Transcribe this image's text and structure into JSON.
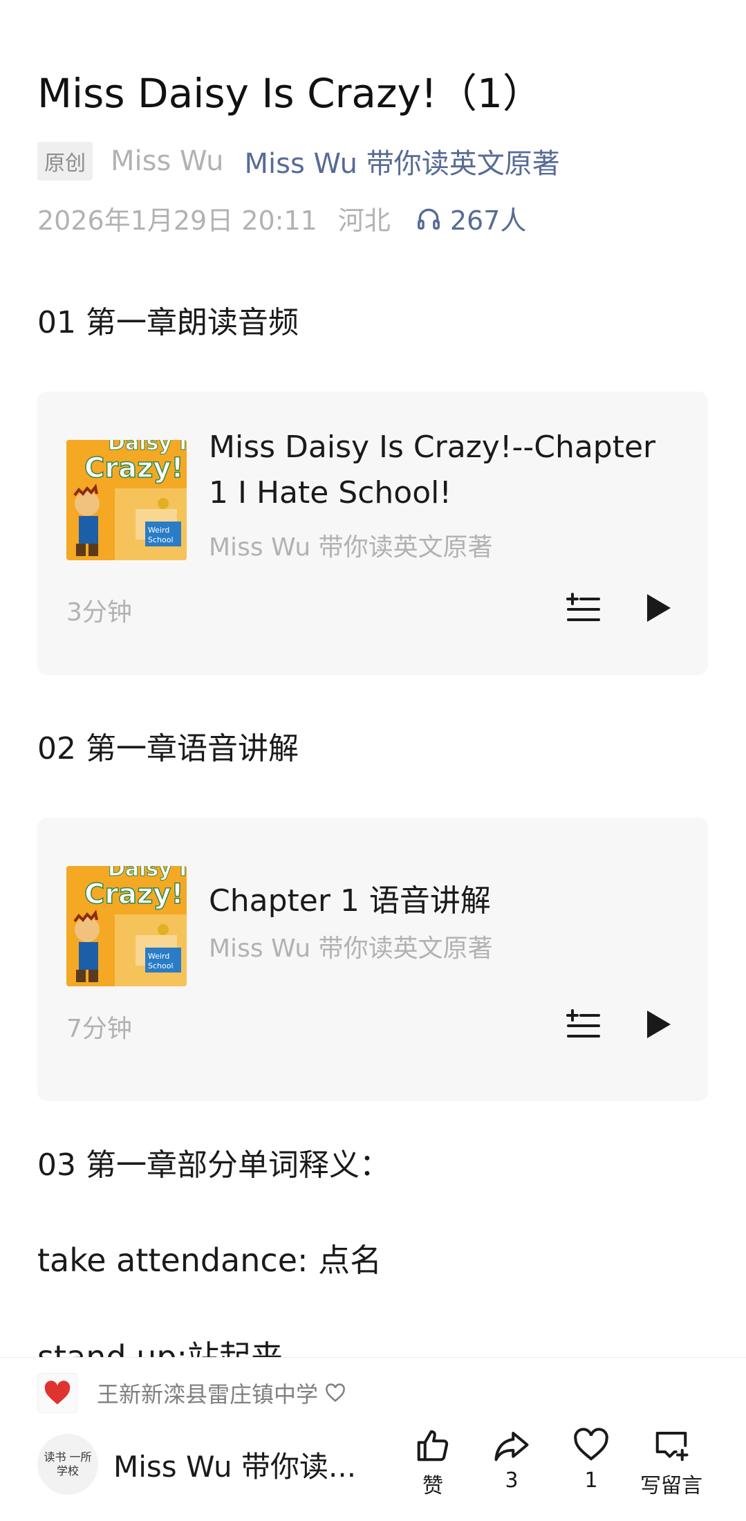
{
  "article": {
    "title": "Miss Daisy Is Crazy!（1）",
    "badge": "原创",
    "author": "Miss Wu",
    "account": "Miss Wu 带你读英文原著",
    "date": "2026年1月29日 20:11",
    "location": "河北",
    "listeners": "267人"
  },
  "sections": [
    {
      "heading": "01 第一章朗读音频"
    },
    {
      "heading": "02 第一章语音讲解"
    },
    {
      "heading": "03 第一章部分单词释义："
    }
  ],
  "audio_cards": [
    {
      "title_line1": "Miss Daisy Is Crazy!--Chapter",
      "title_line2": "1 I Hate School!",
      "subtitle": "Miss Wu 带你读英文原著",
      "duration": "3分钟",
      "cover_icon": "book-cover-icon"
    },
    {
      "title_line1": "Chapter 1 语音讲解",
      "subtitle": "Miss Wu 带你读英文原著",
      "duration": "7分钟",
      "cover_icon": "book-cover-icon"
    }
  ],
  "body": {
    "line1": "take attendance: 点名",
    "line2": "stand up:站起来"
  },
  "bottom": {
    "liker": "王新新滦县雷庄镇中学",
    "account_name": "Miss Wu 带你读...",
    "avatar_text": "读书 一所学校",
    "actions": [
      {
        "icon": "thumbs-up-icon",
        "label": "赞"
      },
      {
        "icon": "share-icon",
        "label": "3"
      },
      {
        "icon": "heart-icon",
        "label": "1"
      },
      {
        "icon": "comment-icon",
        "label": "写留言"
      }
    ]
  },
  "colors": {
    "link": "#576b95",
    "muted": "#b2b2b2",
    "card_bg": "#f7f7f7",
    "heart": "#e0322f"
  }
}
